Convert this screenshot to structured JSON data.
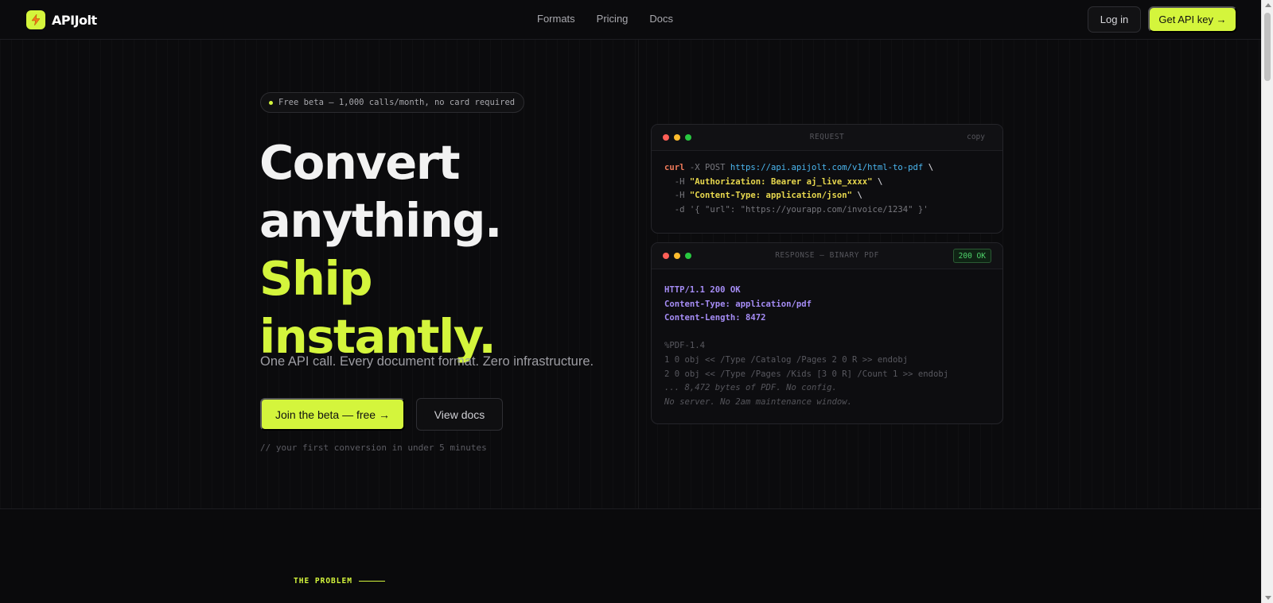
{
  "nav": {
    "brand": "APIJolt",
    "links": [
      "Formats",
      "Pricing",
      "Docs"
    ],
    "login": "Log in",
    "cta": "Get API key →"
  },
  "hero": {
    "badge": "Free beta — 1,000 calls/month, no card required",
    "headline": [
      "Convert",
      "anything.",
      "Ship",
      "instantly."
    ],
    "subhead": "One API call. Every document format. Zero infrastructure.",
    "primary_cta": "Join the beta — free →",
    "secondary_cta": "View docs",
    "hint": "// your first conversion in under 5 minutes"
  },
  "request_card": {
    "title": "REQUEST",
    "copy_label": "copy",
    "lines": [
      {
        "cmd": "curl",
        "flag": " -X POST ",
        "url": "https://api.apijolt.com/v1/html-to-pdf",
        "end": " \\"
      },
      {
        "flag": "  -H ",
        "str": "\"Authorization: Bearer aj_live_xxxx\"",
        "end": " \\"
      },
      {
        "flag": "  -H ",
        "str": "\"Content-Type: application/json\"",
        "end": " \\"
      },
      {
        "flag": "  -d ",
        "dim": "'{ \"url\": \"https://yourapp.com/invoice/1234\" }'"
      }
    ]
  },
  "response_card": {
    "title": "RESPONSE — BINARY PDF",
    "status": "200 OK",
    "headers": [
      "HTTP/1.1 200 OK",
      "Content-Type: application/pdf",
      "Content-Length: 8472"
    ],
    "body": [
      "%PDF-1.4",
      "1 0 obj << /Type /Catalog /Pages 2 0 R >> endobj",
      "2 0 obj << /Type /Pages /Kids [3 0 R] /Count 1 >> endobj"
    ],
    "comments": [
      "... 8,472 bytes of PDF. No config.",
      "No server. No 2am maintenance window."
    ]
  },
  "next_section": {
    "label": "THE PROBLEM"
  },
  "colors": {
    "accent": "#d4f53c",
    "background": "#0b0b0d",
    "dot_red": "#ff5f57",
    "dot_yellow": "#febc2e",
    "dot_green": "#28c840"
  },
  "icons": {
    "logo": "lightning-bolt-icon"
  }
}
